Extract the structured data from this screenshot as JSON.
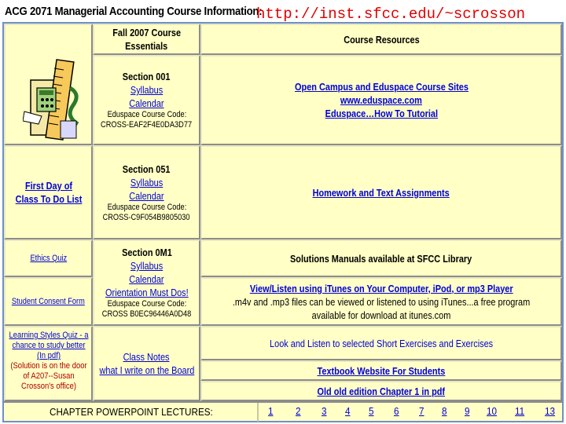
{
  "header": {
    "title": "ACG 2071 Managerial Accounting Course Information:",
    "url": "http://inst.sfcc.edu/~scrosson"
  },
  "essentials": {
    "heading_line1": "Fall 2007 Course",
    "heading_line2": "Essentials",
    "sections": [
      {
        "title": "Section 001",
        "syllabus": "Syllabus",
        "calendar": "Calendar",
        "code_label": "Eduspace Course Code:",
        "code": "CROSS-EAF2F4E0DA3D77"
      },
      {
        "title": "Section 051",
        "syllabus": "Syllabus",
        "calendar": "Calendar",
        "code_label": "Eduspace Course Code:",
        "code": "CROSS-C9F054B9805030"
      },
      {
        "title": "Section 0M1",
        "syllabus": "Syllabus",
        "calendar": "Calendar",
        "orientation": "Orientation Must Dos!",
        "code_label": "Eduspace Course Code:",
        "code": "CROSS B0EC96446A0D48"
      }
    ],
    "class_notes": "Class Notes",
    "class_notes_sub": "what I write on the Board"
  },
  "left_links": {
    "first_day": "First Day of Class To Do List",
    "ethics_quiz": "Ethics Quiz",
    "consent_form": "Student Consent Form",
    "learning_styles": "Learning Styles Quiz - a chance to study better (In pdf)",
    "learning_note": "(Solution is on the door of A207--Susan Crosson's office)"
  },
  "resources": {
    "heading": "Course Resources",
    "open_campus": "Open Campus and Eduspace Course Sites",
    "eduspace_site": "www.eduspace.com",
    "eduspace_howto": "Eduspace…How To Tutorial",
    "homework": "Homework and Text Assignments",
    "solutions": "Solutions Manuals available at SFCC Library",
    "itunes_link": "View/Listen using iTunes on Your Computer, iPod, or mp3 Player",
    "itunes_note": ".m4v and .mp3 files can be viewed or listened to using iTunes...a free program available for download at itunes.com",
    "exercises": "Look and Listen to selected Short Exercises and Exercises",
    "textbook_site": "Textbook Website For Students",
    "old_edition": "Old old edition Chapter 1 in pdf"
  },
  "lectures": {
    "label": "CHAPTER POWERPOINT LECTURES:",
    "chapters": [
      "1",
      "2",
      "3",
      "4",
      "5",
      "6",
      "7",
      "8",
      "9",
      "10",
      "11",
      "13"
    ]
  },
  "colors": {
    "cell_bg": "#ffffc6",
    "link": "#0000d8",
    "url_red": "#e00000",
    "frame": "#6f8fc8"
  },
  "icons": {
    "clipart": "accounting-clipart-icon"
  }
}
